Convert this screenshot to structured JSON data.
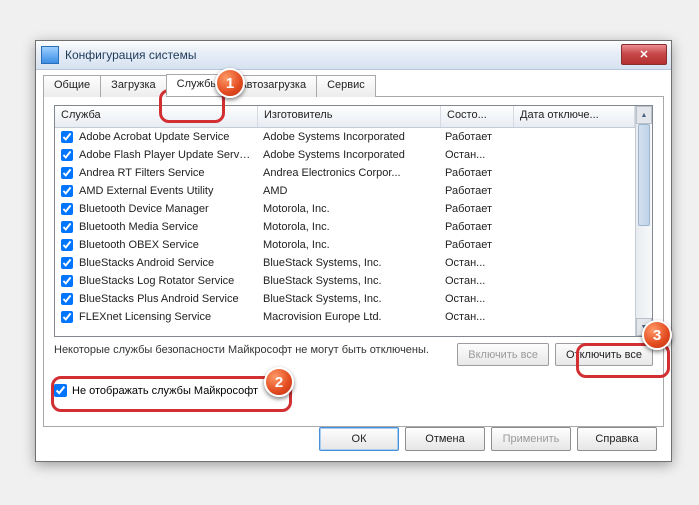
{
  "window": {
    "title": "Конфигурация системы"
  },
  "tabs": [
    "Общие",
    "Загрузка",
    "Службы",
    "Автозагрузка",
    "Сервис"
  ],
  "active_tab": 2,
  "columns": [
    "Служба",
    "Изготовитель",
    "Состо...",
    "Дата отключе..."
  ],
  "rows": [
    {
      "name": "Adobe Acrobat Update Service",
      "vendor": "Adobe Systems Incorporated",
      "state": "Работает"
    },
    {
      "name": "Adobe Flash Player Update Service",
      "vendor": "Adobe Systems Incorporated",
      "state": "Остан..."
    },
    {
      "name": "Andrea RT Filters Service",
      "vendor": "Andrea Electronics Corpor...",
      "state": "Работает"
    },
    {
      "name": "AMD External Events Utility",
      "vendor": "AMD",
      "state": "Работает"
    },
    {
      "name": "Bluetooth Device Manager",
      "vendor": "Motorola, Inc.",
      "state": "Работает"
    },
    {
      "name": "Bluetooth Media Service",
      "vendor": "Motorola, Inc.",
      "state": "Работает"
    },
    {
      "name": "Bluetooth OBEX Service",
      "vendor": "Motorola, Inc.",
      "state": "Работает"
    },
    {
      "name": "BlueStacks Android Service",
      "vendor": "BlueStack Systems, Inc.",
      "state": "Остан..."
    },
    {
      "name": "BlueStacks Log Rotator Service",
      "vendor": "BlueStack Systems, Inc.",
      "state": "Остан..."
    },
    {
      "name": "BlueStacks Plus Android Service",
      "vendor": "BlueStack Systems, Inc.",
      "state": "Остан..."
    },
    {
      "name": "FLEXnet Licensing Service",
      "vendor": "Macrovision Europe Ltd.",
      "state": "Остан..."
    }
  ],
  "note": "Некоторые службы безопасности Майкрософт не могут быть отключены.",
  "enable_all": "Включить все",
  "disable_all": "Отключить все",
  "hide_ms": "Не отображать службы Майкрософт",
  "buttons": {
    "ok": "ОК",
    "cancel": "Отмена",
    "apply": "Применить",
    "help": "Справка"
  },
  "badges": [
    "1",
    "2",
    "3"
  ]
}
